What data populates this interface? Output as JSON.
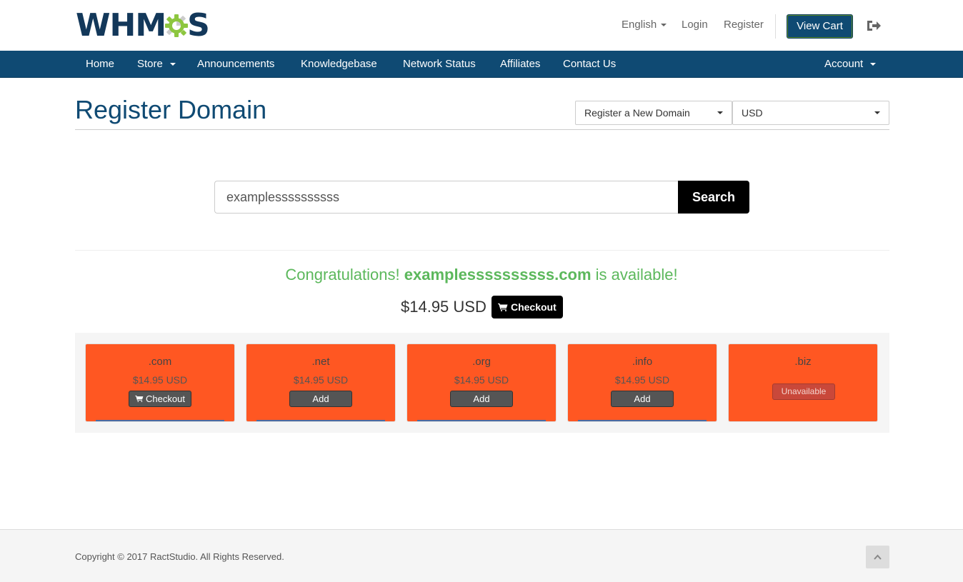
{
  "header": {
    "logo_text_left": "WHM",
    "logo_text_right": "S",
    "language": "English",
    "login": "Login",
    "register": "Register",
    "view_cart": "View Cart"
  },
  "nav": {
    "items": [
      {
        "label": "Home"
      },
      {
        "label": "Store"
      },
      {
        "label": "Announcements"
      },
      {
        "label": "Knowledgebase"
      },
      {
        "label": "Network Status"
      },
      {
        "label": "Affiliates"
      },
      {
        "label": "Contact Us"
      }
    ],
    "account": "Account"
  },
  "page": {
    "title": "Register Domain",
    "domain_action": "Register a New Domain",
    "currency": "USD"
  },
  "search": {
    "value": "examplessssssssss",
    "button": "Search"
  },
  "result": {
    "congrats_prefix": "Congratulations!",
    "domain": "examplessssssssss.com",
    "congrats_suffix": "is available!",
    "price": "$14.95 USD",
    "checkout": "Checkout"
  },
  "suggestions": [
    {
      "tld": ".com",
      "price": "$14.95 USD",
      "action": "Checkout"
    },
    {
      "tld": ".net",
      "price": "$14.95 USD",
      "action": "Add"
    },
    {
      "tld": ".org",
      "price": "$14.95 USD",
      "action": "Add"
    },
    {
      "tld": ".info",
      "price": "$14.95 USD",
      "action": "Add"
    },
    {
      "tld": ".biz",
      "price": "",
      "action": "Unavailable"
    }
  ],
  "footer": {
    "copyright": "Copyright © 2017 RactStudio. All Rights Reserved."
  },
  "colors": {
    "brand": "#0f4a73",
    "success": "#5cb85c",
    "card": "#ff5722"
  }
}
